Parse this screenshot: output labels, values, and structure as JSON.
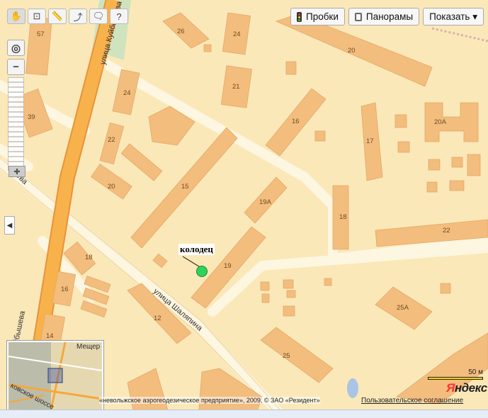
{
  "toolbar": {
    "tools": [
      "hand-icon",
      "zoom-area-icon",
      "ruler-icon",
      "route-icon",
      "placemark-icon",
      "info-cursor-icon"
    ]
  },
  "top_buttons": {
    "traffic": "Пробки",
    "panoramas": "Панорамы",
    "show": "Показать ▾"
  },
  "streets": {
    "kuybysheva_top": "улица Куйбышева",
    "kuybysheva_bottom": "улица Куйбышева",
    "shalyapina": "улица Шаляпина",
    "left_cut": "ева"
  },
  "building_numbers": [
    "57",
    "26",
    "24",
    "20",
    "21",
    "24",
    "16",
    "39",
    "17",
    "20А",
    "22",
    "20",
    "15",
    "19А",
    "18",
    "22",
    "19",
    "18",
    "16",
    "12",
    "14",
    "25А",
    "25"
  ],
  "marker": {
    "label": "колодец",
    "color": "#2fd35a"
  },
  "minimap": {
    "label_top": "Мещер",
    "label_bottom": "ковское шоссе"
  },
  "scale": {
    "label": "50 м"
  },
  "logo": {
    "first": "Я",
    "rest": "ндекс"
  },
  "copyright": "«невольжское аэрогеодезическое предприятие», 2009, © ЗАО «Резидент»",
  "agreement": "Пользовательское соглашение",
  "colors": {
    "background": "#fbe8b8",
    "building": "#f3bd7e",
    "major_road": "#f6a83a",
    "minor_road": "#fdf6e0",
    "park": "#cfe3bf"
  }
}
